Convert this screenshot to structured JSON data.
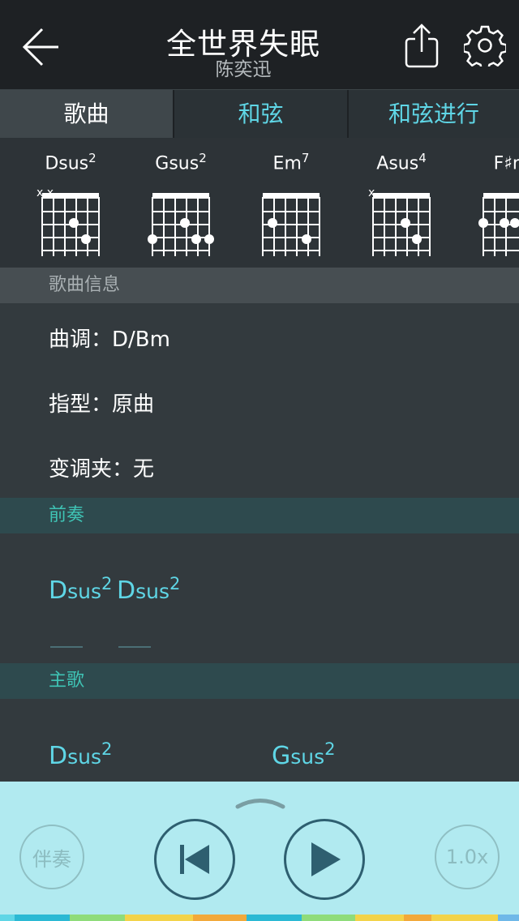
{
  "header": {
    "title": "全世界失眠",
    "subtitle": "陈奕迅",
    "back_icon": "arrow-left-icon",
    "share_icon": "share-icon",
    "settings_icon": "gear-icon"
  },
  "tabs": [
    {
      "label": "歌曲",
      "active": true
    },
    {
      "label": "和弦",
      "active": false
    },
    {
      "label": "和弦进行",
      "active": false
    }
  ],
  "chords": [
    {
      "root": "D",
      "suffix": "sus",
      "sup": "2",
      "muted": "x x"
    },
    {
      "root": "G",
      "suffix": "sus",
      "sup": "2",
      "muted": ""
    },
    {
      "root": "E",
      "suffix": "m",
      "sup": "7",
      "muted": ""
    },
    {
      "root": "A",
      "suffix": "sus",
      "sup": "4",
      "muted": "x"
    },
    {
      "root": "F",
      "suffix": "♯m",
      "sup": "",
      "muted": ""
    }
  ],
  "song_info": {
    "header": "歌曲信息",
    "key_label": "曲调：",
    "key_value": "D/Bm",
    "fingering_label": "指型：",
    "fingering_value": "原曲",
    "capo_label": "变调夹：",
    "capo_value": "无"
  },
  "intro": {
    "header": "前奏",
    "chords": [
      {
        "root": "D",
        "suffix": "sus",
        "sup": "2"
      },
      {
        "root": "D",
        "suffix": "sus",
        "sup": "2"
      }
    ]
  },
  "verse": {
    "header": "主歌",
    "chords": [
      {
        "root": "D",
        "suffix": "sus",
        "sup": "2"
      },
      {
        "root": "G",
        "suffix": "sus",
        "sup": "2"
      }
    ]
  },
  "player": {
    "accompaniment_label": "伴奏",
    "speed_label": "1.0x",
    "prev_icon": "skip-previous-icon",
    "play_icon": "play-icon",
    "handle_icon": "chevron-up-icon"
  },
  "colors": {
    "accent": "#5fd6e6",
    "header_bg": "#1e2124",
    "player_bg": "#b1eaf0",
    "section_bg": "#2e4a4e",
    "button_dark": "#2e5f70"
  }
}
